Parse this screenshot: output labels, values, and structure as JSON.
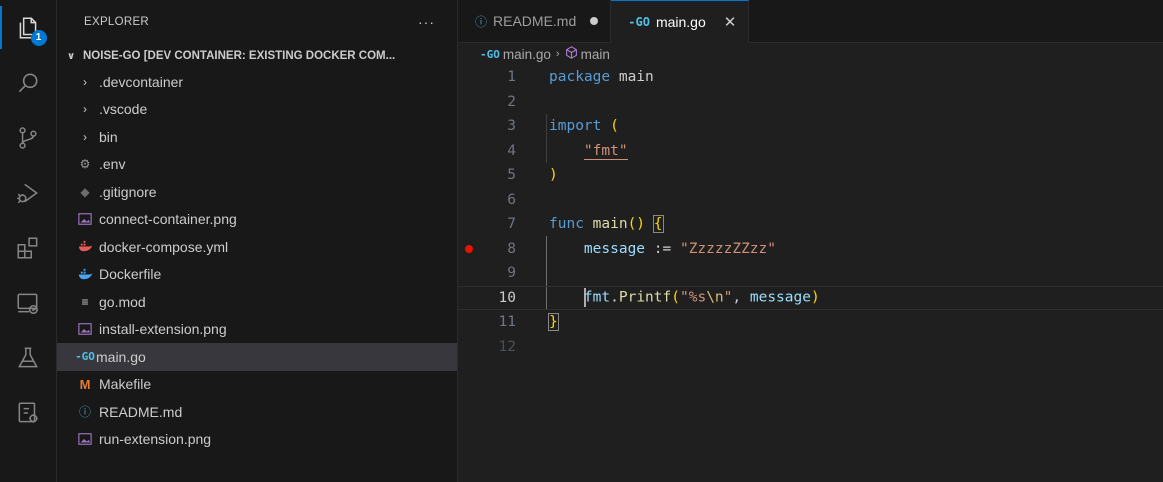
{
  "activity_bar": {
    "items": [
      {
        "icon": "explorer-icon",
        "badge": "1"
      },
      {
        "icon": "search-icon"
      },
      {
        "icon": "source-control-icon"
      },
      {
        "icon": "run-debug-icon"
      },
      {
        "icon": "extensions-icon"
      },
      {
        "icon": "remote-explorer-icon"
      },
      {
        "icon": "testing-icon"
      },
      {
        "icon": "containers-icon"
      }
    ]
  },
  "sidebar": {
    "title": "EXPLORER",
    "more": "···",
    "section": "NOISE-GO [DEV CONTAINER: EXISTING DOCKER COM...",
    "items": [
      {
        "label": ".devcontainer",
        "type": "folder"
      },
      {
        "label": ".vscode",
        "type": "folder"
      },
      {
        "label": "bin",
        "type": "folder"
      },
      {
        "label": ".env",
        "type": "gear"
      },
      {
        "label": ".gitignore",
        "type": "git"
      },
      {
        "label": "connect-container.png",
        "type": "image"
      },
      {
        "label": "docker-compose.yml",
        "type": "docker-red"
      },
      {
        "label": "Dockerfile",
        "type": "docker-blue"
      },
      {
        "label": "go.mod",
        "type": "lines"
      },
      {
        "label": "install-extension.png",
        "type": "image"
      },
      {
        "label": "main.go",
        "type": "go",
        "selected": true
      },
      {
        "label": "Makefile",
        "type": "make"
      },
      {
        "label": "README.md",
        "type": "info"
      },
      {
        "label": "run-extension.png",
        "type": "image"
      }
    ]
  },
  "tabs": [
    {
      "label": "README.md",
      "icon": "ⓘ",
      "modified": true
    },
    {
      "label": "main.go",
      "icon": "-GO",
      "active": true,
      "close": "✕"
    }
  ],
  "breadcrumb": {
    "file": "main.go",
    "separator": "›",
    "symbol": "main"
  },
  "code": {
    "lines": [
      "1",
      "2",
      "3",
      "4",
      "5",
      "6",
      "7",
      "8",
      "9",
      "10",
      "11",
      "12"
    ],
    "current_line": "10",
    "breakpoint_line": "8",
    "t_package": "package",
    "t_main": "main",
    "t_import": "import",
    "t_lparen": "(",
    "t_fmt_str": "\"fmt\"",
    "t_rparen": ")",
    "t_func": "func",
    "t_main_fn": "main",
    "t_empty_parens": "()",
    "t_lbrace": "{",
    "t_message": "message",
    "t_assign": ":=",
    "t_msg_str": "\"ZzzzzZZzz\"",
    "t_fmt": "fmt",
    "t_dot": ".",
    "t_printf": "Printf",
    "t_p_open": "(",
    "t_fmt_arg_a": "\"%s",
    "t_fmt_arg_esc": "\\n",
    "t_fmt_arg_b": "\"",
    "t_comma": ",",
    "t_arg": "message",
    "t_p_close": ")",
    "t_rbrace": "}"
  }
}
